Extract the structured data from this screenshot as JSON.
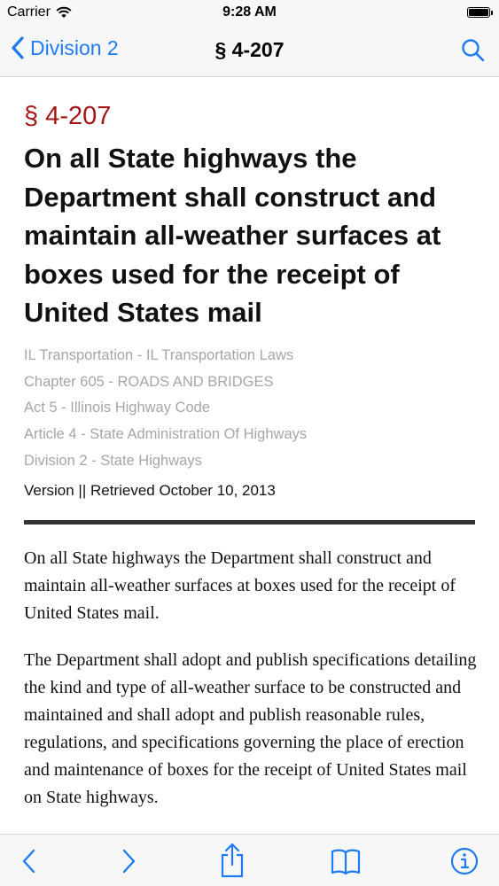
{
  "status_bar": {
    "carrier": "Carrier",
    "time": "9:28 AM",
    "battery_level": 1.0
  },
  "nav": {
    "back_label": "Division 2",
    "title": "§ 4-207",
    "search_icon": "search-icon"
  },
  "article": {
    "section_number": "§ 4-207",
    "heading": "On all State highways the Department shall construct and maintain all-weather surfaces at boxes used for the receipt of United States mail",
    "breadcrumbs": [
      "IL Transportation - IL Transportation Laws",
      "Chapter 605 - ROADS AND BRIDGES",
      "Act 5 - Illinois Highway Code",
      "Article 4 - State Administration Of Highways",
      "Division 2 - State Highways"
    ],
    "version": "Version || Retrieved October 10, 2013",
    "paragraphs": [
      "On all State highways the Department shall construct and maintain all-weather surfaces at boxes used for the receipt of United States mail.",
      "The Department shall adopt and publish specifications detailing the kind and type of all-weather surface to be constructed and maintained and shall adopt and publish reasonable rules, regulations, and specifications governing the place of erection and maintenance of boxes for the receipt of United States mail on State highways."
    ]
  },
  "toolbar": {
    "buttons": [
      "chevron-left-icon",
      "chevron-right-icon",
      "share-icon",
      "book-icon",
      "info-icon"
    ]
  },
  "colors": {
    "accent": "#1f7bf2",
    "section_number": "#a31515",
    "breadcrumb": "#a6a6a6"
  }
}
